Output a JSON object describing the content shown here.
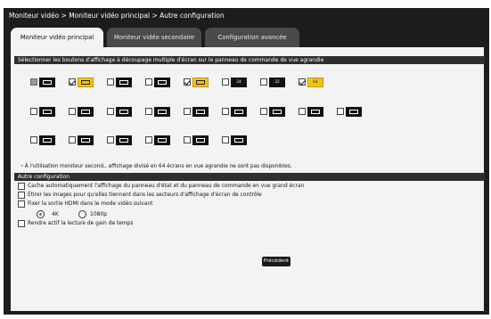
{
  "breadcrumb": "Moniteur vidéo > Moniteur vidéo principal > Autre configuration",
  "tabs": [
    {
      "label": "Moniteur vidéo principal",
      "active": true
    },
    {
      "label": "Moniteur vidéo secondaire",
      "active": false
    },
    {
      "label": "Configuration avancée",
      "active": false
    }
  ],
  "split_section": {
    "title": "Sélectionner les boutons d'affichage à découpage multiple d'écran sur le panneau de commande de vue agrandie",
    "rows": [
      [
        {
          "icon": "single-screen-icon",
          "checked": false,
          "disabled": true,
          "highlighted": false,
          "label": ""
        },
        {
          "icon": "quad-split-icon",
          "checked": true,
          "disabled": false,
          "highlighted": true,
          "label": ""
        },
        {
          "icon": "nine-split-icon",
          "checked": false,
          "disabled": false,
          "highlighted": false,
          "label": ""
        },
        {
          "icon": "sixteen-split-icon",
          "checked": false,
          "disabled": false,
          "highlighted": false,
          "label": ""
        },
        {
          "icon": "thirty-two-split-icon",
          "checked": true,
          "disabled": false,
          "highlighted": true,
          "label": ""
        },
        {
          "icon": "twenty-four-split-icon",
          "checked": false,
          "disabled": false,
          "highlighted": false,
          "label": "24"
        },
        {
          "icon": "thirty-two-grid-icon",
          "checked": false,
          "disabled": false,
          "highlighted": false,
          "label": "32"
        },
        {
          "icon": "sixty-four-split-icon",
          "checked": true,
          "disabled": false,
          "highlighted": true,
          "label": "64"
        }
      ],
      [
        {
          "icon": "wide-single-icon",
          "checked": false,
          "disabled": false,
          "highlighted": false,
          "label": ""
        },
        {
          "icon": "wide-quad-icon",
          "checked": false,
          "disabled": false,
          "highlighted": false,
          "label": ""
        },
        {
          "icon": "wide-nine-icon",
          "checked": false,
          "disabled": false,
          "highlighted": false,
          "label": ""
        },
        {
          "icon": "wide-sixteen-icon",
          "checked": false,
          "disabled": false,
          "highlighted": false,
          "label": ""
        },
        {
          "icon": "large-plus-small-icon",
          "checked": false,
          "disabled": false,
          "highlighted": false,
          "label": ""
        },
        {
          "icon": "large-plus-grid-icon",
          "checked": false,
          "disabled": false,
          "highlighted": false,
          "label": ""
        },
        {
          "icon": "large-plus-strip-icon",
          "checked": false,
          "disabled": false,
          "highlighted": false,
          "label": ""
        },
        {
          "icon": "side-strip-icon",
          "checked": false,
          "disabled": false,
          "highlighted": false,
          "label": ""
        },
        {
          "icon": "side-strip-alt-icon",
          "checked": false,
          "disabled": false,
          "highlighted": false,
          "label": ""
        }
      ],
      [
        {
          "icon": "dual-split-icon",
          "checked": false,
          "disabled": false,
          "highlighted": false,
          "label": ""
        },
        {
          "icon": "triple-split-icon",
          "checked": false,
          "disabled": false,
          "highlighted": false,
          "label": ""
        },
        {
          "icon": "quad-column-icon",
          "checked": false,
          "disabled": false,
          "highlighted": false,
          "label": ""
        },
        {
          "icon": "mixed-split-icon",
          "checked": false,
          "disabled": false,
          "highlighted": false,
          "label": ""
        },
        {
          "icon": "mixed-split-alt-icon",
          "checked": false,
          "disabled": false,
          "highlighted": false,
          "label": ""
        },
        {
          "icon": "mixed-grid-icon",
          "checked": false,
          "disabled": false,
          "highlighted": false,
          "label": ""
        }
      ]
    ],
    "note": "・À l'utilisation moniteur second., affichage divisé en 64 écrans en vue agrandie ne sont pas disponibles."
  },
  "other_section": {
    "title": "Autre configuration",
    "options": [
      {
        "label": "Cache automatiquement l'affichage du panneau d'état et du panneau de commande en vue grand écran",
        "checked": false
      },
      {
        "label": "Étirer les images pour qu'elles tiennent dans les secteurs d'affichage d'écran de contrôle",
        "checked": false
      },
      {
        "label": "Fixer la sortie HDMI dans le mode vidéo suivant",
        "checked": false
      },
      {
        "label": "Rendre actif la lecture de gain de temps",
        "checked": false
      }
    ],
    "hdmi_modes": [
      {
        "label": "4K",
        "selected": true
      },
      {
        "label": "1080p",
        "selected": false
      }
    ]
  },
  "back_button": "Précédent",
  "colors": {
    "frame": "#1d1d1d",
    "panel": "#f3f3f3",
    "section_bar": "#2f2f2f",
    "checked_icon": "#f3c417",
    "radio_on": "#1aa34a"
  }
}
